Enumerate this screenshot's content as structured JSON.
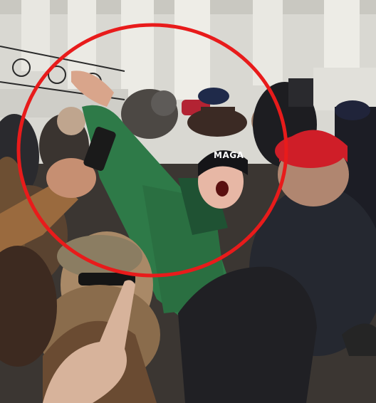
{
  "photo": {
    "beanie_text": "MAGA",
    "highlight": {
      "shape": "circle",
      "color": "#e81b1b"
    },
    "colors": {
      "sky": "#d8d9d6",
      "columns": "#e6e5df",
      "green_coat": "#2e7a48",
      "red_cap": "#cf1e28",
      "dark_clothing": "#1e1e22"
    }
  }
}
